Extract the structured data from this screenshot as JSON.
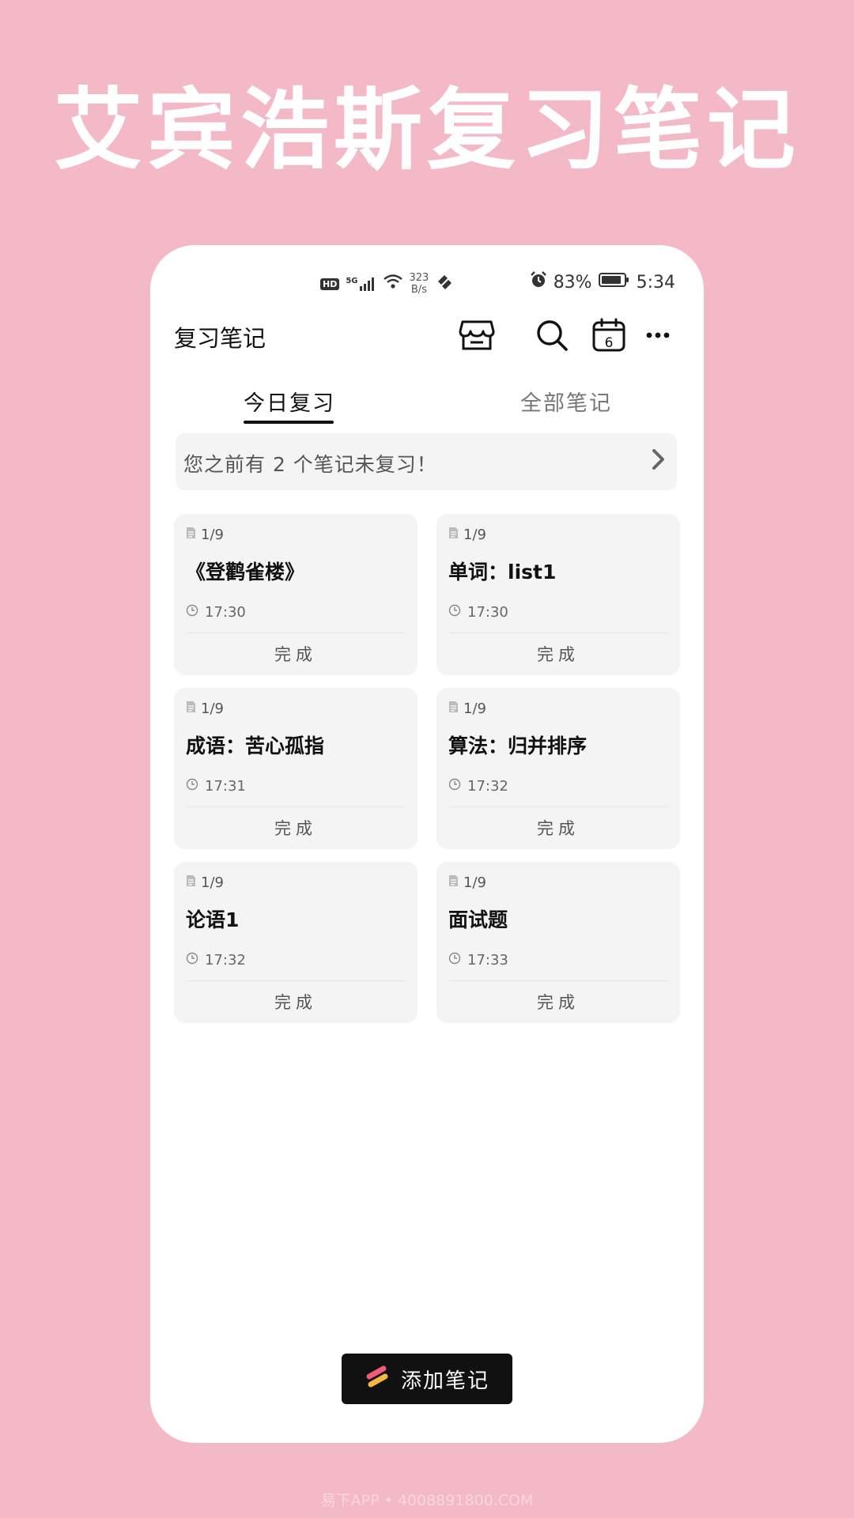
{
  "banner": {
    "title": "艾宾浩斯复习笔记"
  },
  "status_bar": {
    "network_badge": "HD",
    "network_type": "5G",
    "speed_value": "323",
    "speed_unit": "B/s",
    "battery": "83%",
    "time": "5:34"
  },
  "app_bar": {
    "title": "复习笔记",
    "calendar_day": "6"
  },
  "tabs": [
    {
      "label": "今日复习",
      "active": true
    },
    {
      "label": "全部笔记",
      "active": false
    }
  ],
  "notice": {
    "text": "您之前有 2 个笔记未复习！"
  },
  "cards": [
    {
      "count": "1/9",
      "title": "《登鹳雀楼》",
      "time": "17:30",
      "action": "完成"
    },
    {
      "count": "1/9",
      "title": "单词：list1",
      "time": "17:30",
      "action": "完成"
    },
    {
      "count": "1/9",
      "title": "成语：苦心孤指",
      "time": "17:31",
      "action": "完成"
    },
    {
      "count": "1/9",
      "title": "算法：归并排序",
      "time": "17:32",
      "action": "完成"
    },
    {
      "count": "1/9",
      "title": "论语1",
      "time": "17:32",
      "action": "完成"
    },
    {
      "count": "1/9",
      "title": "面试题",
      "time": "17:33",
      "action": "完成"
    }
  ],
  "add_button": {
    "label": "添加笔记"
  },
  "watermark": "易下APP • 4008891800.COM",
  "colors": {
    "background": "#f4b9c7",
    "card": "#f4f4f4",
    "button": "#111111"
  }
}
